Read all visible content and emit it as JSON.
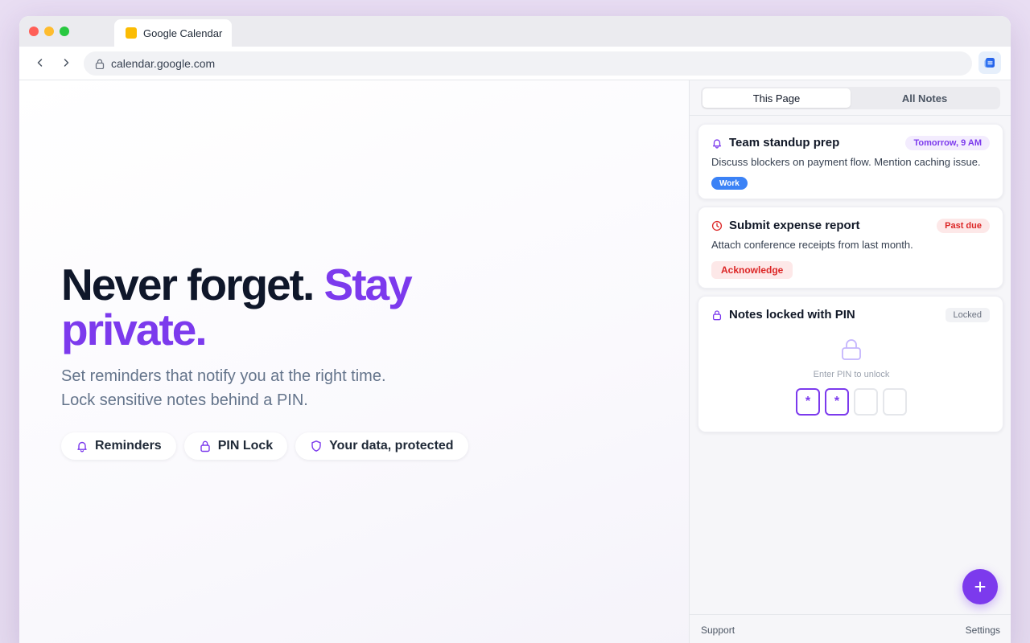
{
  "browser": {
    "tab_title": "Google Calendar",
    "url": "calendar.google.com"
  },
  "hero": {
    "title_part1": "Never forget. ",
    "title_accent": "Stay private.",
    "subtitle_line1": "Set reminders that notify you at the right time.",
    "subtitle_line2": "Lock sensitive notes behind a PIN.",
    "features": [
      {
        "label": "Reminders",
        "icon": "bell-icon"
      },
      {
        "label": "PIN Lock",
        "icon": "lock-icon"
      },
      {
        "label": "Your data, protected",
        "icon": "shield-icon"
      }
    ]
  },
  "panel": {
    "tabs": [
      {
        "label": "This Page",
        "active": true
      },
      {
        "label": "All Notes",
        "active": false
      }
    ],
    "notes": [
      {
        "title": "Team standup prep",
        "icon": "bell-icon",
        "badge": "Tomorrow, 9 AM",
        "body": "Discuss blockers on payment flow. Mention caching issue.",
        "tag": "Work"
      },
      {
        "title": "Submit expense report",
        "icon": "clock-icon",
        "badge": "Past due",
        "body": "Attach conference receipts from last month.",
        "action": "Acknowledge"
      },
      {
        "title": "Notes locked with PIN",
        "icon": "lock-icon",
        "badge": "Locked",
        "pin_prompt": "Enter PIN to unlock",
        "pin_digits": [
          "*",
          "*",
          "",
          ""
        ]
      }
    ],
    "footer": {
      "support": "Support",
      "settings": "Settings"
    }
  },
  "colors": {
    "accent": "#7c3aed",
    "danger": "#dc2626",
    "work_tag": "#3b82f6",
    "favicon": "#fbbc04"
  }
}
